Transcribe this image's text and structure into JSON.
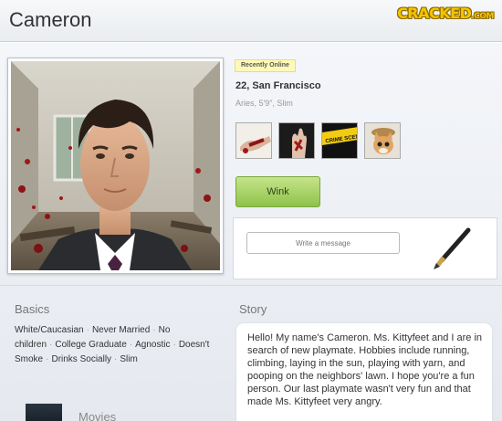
{
  "header": {
    "title": "Cameron",
    "brand": "CRACKED",
    "brand_suffix": ".COM"
  },
  "profile": {
    "status_badge": "Recently Online",
    "age_location": "22, San Francisco",
    "attributes": "Aries, 5'9\", Slim"
  },
  "thumbnails": [
    {
      "icon": "bloody-hands-icon"
    },
    {
      "icon": "bloody-hand-icon"
    },
    {
      "icon": "crime-scene-tape-icon",
      "text": "CRIME SCENE DO NOT"
    },
    {
      "icon": "cat-icon"
    }
  ],
  "actions": {
    "wink_label": "Wink"
  },
  "message": {
    "placeholder": "Write a message"
  },
  "basics": {
    "heading": "Basics",
    "items": [
      "White/Caucasian",
      "Never Married",
      "No children",
      "College Graduate",
      "Agnostic",
      "Doesn't Smoke",
      "Drinks Socially",
      "Slim"
    ]
  },
  "story": {
    "heading": "Story",
    "text": "Hello! My name's Cameron. Ms. Kittyfeet and I are in search of  new playmate. Hobbies include running, climbing, laying in the sun, playing with yarn, and pooping on the neighbors' lawn. I hope you're a fun person. Our last playmate wasn't very fun and that made Ms. Kittyfeet very angry."
  },
  "movies": {
    "heading": "Movies"
  },
  "colors": {
    "wink": "#9ccb56",
    "status": "#fff9b8",
    "brand": "#f4c400",
    "blood": "#a01818"
  }
}
